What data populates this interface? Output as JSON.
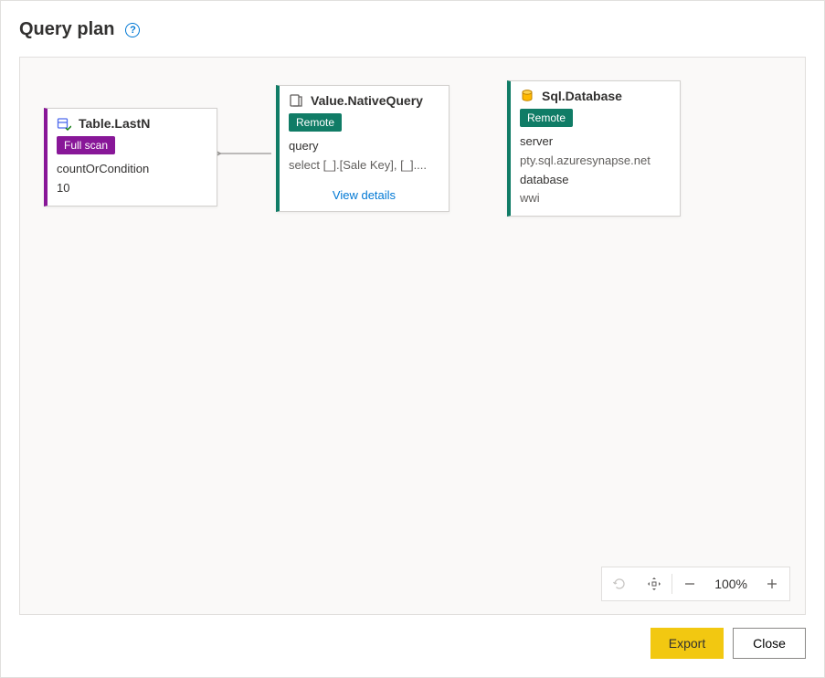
{
  "header": {
    "title": "Query plan"
  },
  "nodes": {
    "tableLastN": {
      "title": "Table.LastN",
      "badge": "Full scan",
      "field1_label": "countOrCondition",
      "field1_value": "10"
    },
    "nativeQuery": {
      "title": "Value.NativeQuery",
      "badge": "Remote",
      "field1_label": "query",
      "field1_value": "select [_].[Sale Key], [_]....",
      "link": "View details"
    },
    "sqlDatabase": {
      "title": "Sql.Database",
      "badge": "Remote",
      "field1_label": "server",
      "field1_value": "pty.sql.azuresynapse.net",
      "field2_label": "database",
      "field2_value": "wwi"
    }
  },
  "zoom": {
    "level": "100%"
  },
  "footer": {
    "export": "Export",
    "close": "Close"
  }
}
